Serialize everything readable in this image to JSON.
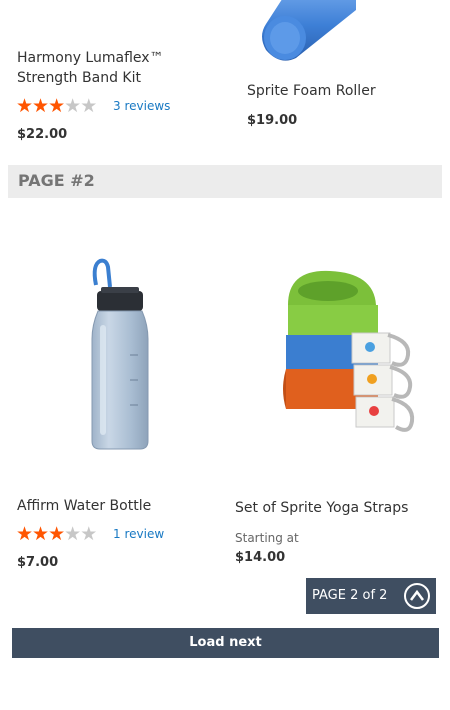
{
  "products_top": [
    {
      "name": "Harmony Lumaflex™ Strength Band Kit",
      "rating": 3,
      "reviews": "3 reviews",
      "price": "$22.00"
    },
    {
      "name": "Sprite Foam Roller",
      "price": "$19.00"
    }
  ],
  "page_header": {
    "label": "PAGE #2"
  },
  "products_page2": [
    {
      "name": "Affirm Water Bottle",
      "rating": 3,
      "reviews": "1 review",
      "price": "$7.00"
    },
    {
      "name": "Set of Sprite Yoga Straps",
      "price_prefix": "Starting at",
      "price": "$14.00"
    }
  ],
  "pagination": {
    "label": "PAGE 2 of 2",
    "icon": "chevron-up-circle-icon"
  },
  "load_next": {
    "label": "Load next"
  },
  "colors": {
    "star_filled": "#ff5501",
    "star_empty": "#c7c7c7",
    "link": "#1979c3",
    "button_bg": "#3f4e61",
    "header_bg": "#ececec"
  }
}
